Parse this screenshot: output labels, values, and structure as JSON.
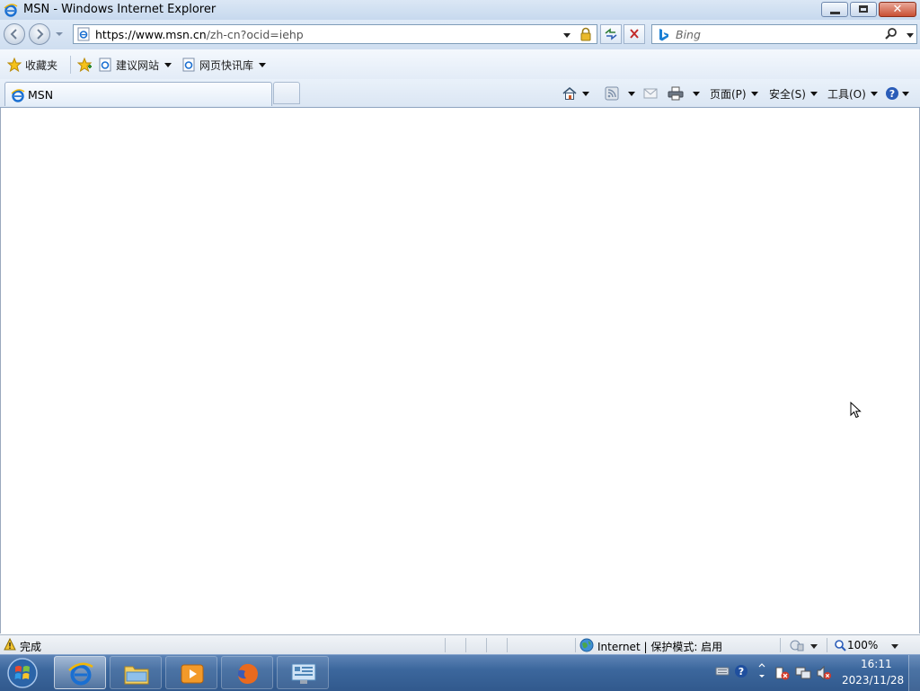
{
  "window": {
    "title": "MSN - Windows Internet Explorer",
    "icon": "ie-icon",
    "controls": [
      "minimize-icon",
      "restore-icon",
      "close-icon"
    ]
  },
  "address_bar": {
    "url_host": "https://www.msn.cn",
    "url_path": "/zh-cn?ocid=iehp",
    "icons": [
      "back-icon",
      "forward-icon",
      "lock-icon",
      "refresh-icon",
      "stop-icon"
    ]
  },
  "search": {
    "placeholder": "Bing",
    "icons": [
      "bing-icon",
      "search-icon"
    ]
  },
  "favorites_bar": {
    "favorites_label": "收藏夹",
    "items": [
      {
        "label": "建议网站",
        "icon": "ie-page-icon"
      },
      {
        "label": "网页快讯库",
        "icon": "ie-page-icon"
      }
    ]
  },
  "tabs": [
    {
      "label": "MSN",
      "icon": "ie-icon",
      "active": true
    }
  ],
  "command_bar": {
    "page_label": "页面(P)",
    "safety_label": "安全(S)",
    "tools_label": "工具(O)",
    "icons": [
      "home-icon",
      "feeds-icon",
      "mail-icon",
      "print-icon",
      "help-icon"
    ]
  },
  "status_bar": {
    "status_text": "完成",
    "zone_text": "Internet | 保护模式: 启用",
    "zoom_text": "100%"
  },
  "taskbar": {
    "pinned": [
      "ie-icon",
      "explorer-folder-icon",
      "media-player-icon",
      "firefox-icon",
      "control-panel-icon"
    ],
    "clock_time": "16:11",
    "clock_date": "2023/11/28"
  },
  "colors": {
    "chrome_blue": "#dbe7f5",
    "taskbar_blue": "#3c679d",
    "close_red": "#c94f33"
  }
}
